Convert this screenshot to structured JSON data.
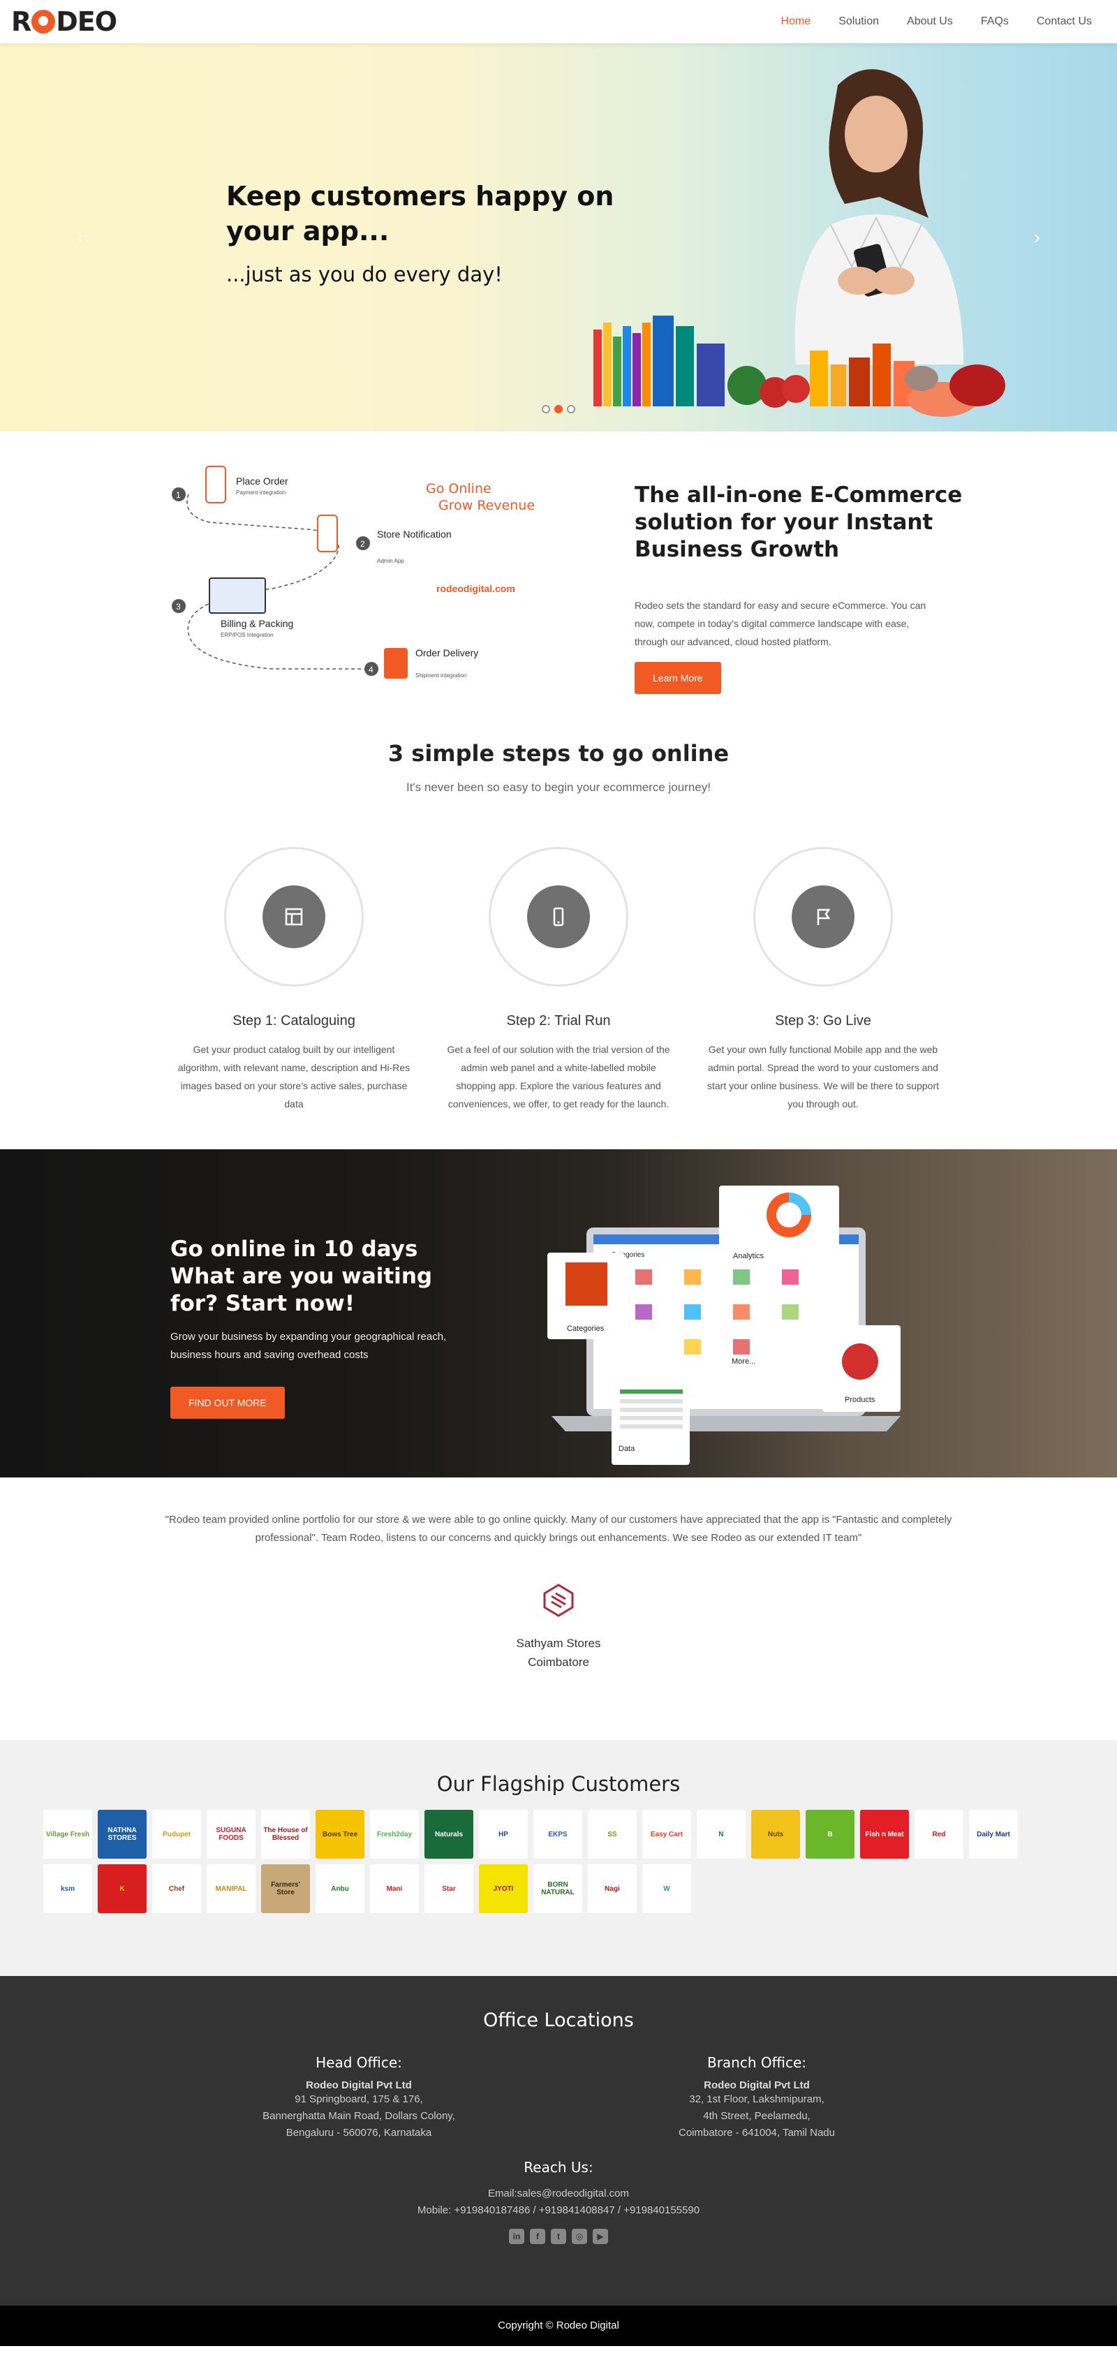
{
  "nav": {
    "logo": "RODEO",
    "items": [
      {
        "label": "Home",
        "active": true
      },
      {
        "label": "Solution"
      },
      {
        "label": "About Us"
      },
      {
        "label": "FAQs"
      },
      {
        "label": "Contact Us"
      }
    ]
  },
  "hero": {
    "title": "Keep customers happy on your app...",
    "subtitle": "...just as you do every day!",
    "arrow_left": "‹",
    "arrow_right": "›",
    "slides": 3,
    "active_slide": 2
  },
  "allinone": {
    "flow": {
      "step1": "Place Order",
      "step1_sub": "Payment integration",
      "step2": "Store Notification",
      "step2_sub": "Admin App",
      "step3": "Billing & Packing",
      "step3_sub": "ERP/POS Integration",
      "step4": "Order Delivery",
      "step4_sub": "Shipment integration",
      "tagline1": "Go Online",
      "tagline2": "Grow Revenue",
      "site": "rodeodigital.com"
    },
    "title": "The all-in-one E-Commerce solution for your Instant Business Growth",
    "text": "Rodeo sets the standard for easy and secure eCommerce. You can now, compete in today's digital commerce landscape with ease, through our advanced, cloud hosted platform.",
    "button": "Learn More"
  },
  "steps": {
    "title": "3 simple steps to go online",
    "subtitle": "It's never been so easy to begin your ecommerce journey!",
    "items": [
      {
        "title": "Step 1: Cataloguing",
        "text": "Get your product catalog built by our intelligent algorithm, with relevant name, description and Hi-Res images based on your store's active sales, purchase data",
        "icon": "catalog-icon"
      },
      {
        "title": "Step 2: Trial Run",
        "text": "Get a feel of our solution with the trial version of the admin web panel and a white-labelled mobile shopping app. Explore the various features and conveniences, we offer, to get ready for the launch.",
        "icon": "mobile-icon"
      },
      {
        "title": "Step 3: Go Live",
        "text": "Get your own fully functional Mobile app and the web admin portal. Spread the word to your customers and start your online business. We will be there to support you through out.",
        "icon": "flag-icon"
      }
    ]
  },
  "band": {
    "title": "Go online in 10 days What are you waiting for? Start now!",
    "text": "Grow your business by expanding your geographical reach, business hours and saving overhead costs",
    "button": "FIND OUT MORE",
    "cards": {
      "categories": "Categories",
      "analytics": "Analytics",
      "products": "Products",
      "data": "Data",
      "more": "More...",
      "screen_title": "Categories"
    }
  },
  "testimonial": {
    "quote": "\"Rodeo team provided online portfolio for our store & we were able to go online quickly. Many of our customers have appreciated that the app is \"Fantastic and completely professional\". Team Rodeo, listens to our concerns and quickly brings out enhancements. We see Rodeo as our extended IT team\"",
    "name": "Sathyam Stores",
    "city": "Coimbatore"
  },
  "customers": {
    "title": "Our Flagship Customers",
    "logos": [
      {
        "text": "Village Fresh",
        "bg": "#ffffff",
        "fg": "#6a9a3a"
      },
      {
        "text": "NATHNA STORES",
        "bg": "#1f5fa8",
        "fg": "#ffffff"
      },
      {
        "text": "Pudupet",
        "bg": "#ffffff",
        "fg": "#c99a1a"
      },
      {
        "text": "SUGUNA FOODS",
        "bg": "#ffffff",
        "fg": "#c8202a"
      },
      {
        "text": "The House of Blessed",
        "bg": "#ffffff",
        "fg": "#a02020"
      },
      {
        "text": "Bows Tree",
        "bg": "#f5c400",
        "fg": "#5a3a00"
      },
      {
        "text": "Fresh2day",
        "bg": "#ffffff",
        "fg": "#4caf50"
      },
      {
        "text": "Naturals",
        "bg": "#1a6b3a",
        "fg": "#ffffff"
      },
      {
        "text": "HP",
        "bg": "#ffffff",
        "fg": "#1a4a9a"
      },
      {
        "text": "EKPS",
        "bg": "#ffffff",
        "fg": "#2a5ab8"
      },
      {
        "text": "SS",
        "bg": "#ffffff",
        "fg": "#6a9a20"
      },
      {
        "text": "Easy Cart",
        "bg": "#ffffff",
        "fg": "#e04020"
      },
      {
        "text": "N",
        "bg": "#ffffff",
        "fg": "#1a7a4a"
      },
      {
        "text": "Nuts",
        "bg": "#f2c21a",
        "fg": "#6a4a00"
      },
      {
        "text": "B",
        "bg": "#6ab82a",
        "fg": "#ffffff"
      },
      {
        "text": "Fish n Meat",
        "bg": "#e41e26",
        "fg": "#ffffff"
      },
      {
        "text": "Red",
        "bg": "#ffffff",
        "fg": "#d01818"
      },
      {
        "text": "Daily Mart",
        "bg": "#ffffff",
        "fg": "#1a3a8a"
      },
      {
        "text": "ksm",
        "bg": "#ffffff",
        "fg": "#1a5ab8"
      },
      {
        "text": "K",
        "bg": "#d81e1e",
        "fg": "#f5d000"
      },
      {
        "text": "Chef",
        "bg": "#ffffff",
        "fg": "#8a3a1a"
      },
      {
        "text": "MANIPAL",
        "bg": "#ffffff",
        "fg": "#c48a10"
      },
      {
        "text": "Farmers' Store",
        "bg": "#c8a878",
        "fg": "#3a2a10"
      },
      {
        "text": "Anbu",
        "bg": "#ffffff",
        "fg": "#2a7a2a"
      },
      {
        "text": "Mani",
        "bg": "#ffffff",
        "fg": "#d02020"
      },
      {
        "text": "Star",
        "bg": "#ffffff",
        "fg": "#d02020"
      },
      {
        "text": "JYOTI",
        "bg": "#f5e400",
        "fg": "#c01010"
      },
      {
        "text": "BORN NATURAL",
        "bg": "#ffffff",
        "fg": "#2a6a2a"
      },
      {
        "text": "Nagi",
        "bg": "#ffffff",
        "fg": "#c01818"
      },
      {
        "text": "W",
        "bg": "#ffffff",
        "fg": "#2a9a6a"
      }
    ]
  },
  "footer": {
    "title": "Office Locations",
    "head": {
      "heading": "Head Office:",
      "company": "Rodeo Digital Pvt Ltd",
      "line1": "91 Springboard, 175 & 176,",
      "line2": "Bannerghatta Main Road, Dollars Colony,",
      "line3": "Bengaluru - 560076, Karnataka"
    },
    "branch": {
      "heading": "Branch Office:",
      "company": "Rodeo Digital Pvt Ltd",
      "line1": "32, 1st Floor, Lakshmipuram,",
      "line2": "4th Street, Peelamedu,",
      "line3": "Coimbatore - 641004, Tamil Nadu"
    },
    "reach": {
      "heading": "Reach Us:",
      "email": "Email:sales@rodeodigital.com",
      "mobile": "Mobile: +919840187486 / +919841408847 / +919840155590"
    },
    "social": [
      {
        "name": "linkedin-icon",
        "glyph": "in"
      },
      {
        "name": "facebook-icon",
        "glyph": "f"
      },
      {
        "name": "twitter-icon",
        "glyph": "t"
      },
      {
        "name": "instagram-icon",
        "glyph": "◎"
      },
      {
        "name": "youtube-icon",
        "glyph": "▶"
      }
    ],
    "copyright": "Copyright © Rodeo Digital"
  },
  "colors": {
    "accent": "#f15a24",
    "footer_bg": "#333333"
  }
}
